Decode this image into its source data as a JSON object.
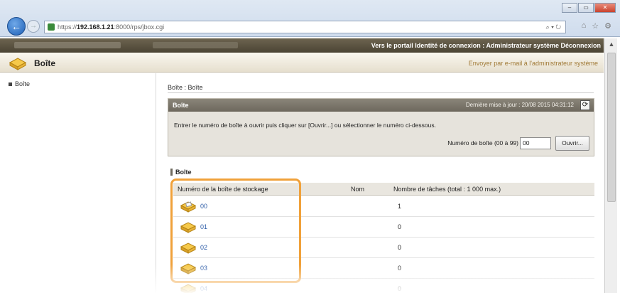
{
  "browser": {
    "url_prefix": "https://",
    "url_host": "192.168.1.21",
    "url_rest": ":8000/rps/jbox.cgi",
    "search_hint": "⌕ ▾ ↻",
    "win_min": "–",
    "win_max": "▭",
    "win_close": "✕",
    "back": "←",
    "fwd": "→",
    "home_icon": "⌂",
    "star_icon": "☆",
    "gear_icon": "⚙"
  },
  "header": {
    "links": "Vers le portail  Identité de connexion : Administrateur système  Déconnexion",
    "title": "Boîte",
    "mail_link": "Envoyer par e-mail à l'administrateur système"
  },
  "sidebar": {
    "items": [
      {
        "label": "Boîte"
      }
    ]
  },
  "main": {
    "breadcrumb": "Boîte : Boîte",
    "panel": {
      "title": "Boîte",
      "updated": "Dernière mise à jour : 20/08 2015 04:31:12",
      "refresh_icon": "⟳",
      "instruction": "Entrer le numéro de boîte à ouvrir puis cliquer sur [Ouvrir...] ou sélectionner le numéro ci-dessous.",
      "number_label": "Numéro de boîte (00 à 99)",
      "number_value": "00",
      "open_button": "Ouvrir..."
    },
    "section_title": "Boîte",
    "table": {
      "col_box": "Numéro de la boîte de stockage",
      "col_name": "Nom",
      "col_count": "Nombre de tâches (total : 1 000 max.)",
      "rows": [
        {
          "number": "00",
          "count": "1"
        },
        {
          "number": "01",
          "count": "0"
        },
        {
          "number": "02",
          "count": "0"
        },
        {
          "number": "03",
          "count": "0"
        },
        {
          "number": "04",
          "count": "0"
        }
      ]
    }
  },
  "colors": {
    "highlight": "#f0a13a",
    "link": "#2a5aa6",
    "header_dark": "#4b4434"
  }
}
